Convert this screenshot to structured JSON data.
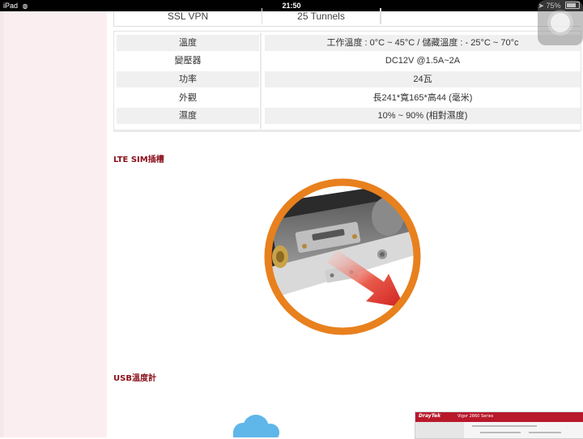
{
  "status_bar": {
    "device": "iPad",
    "time": "21:50",
    "battery": "75%"
  },
  "top_table": {
    "col1": "SSL VPN",
    "col2": "25 Tunnels"
  },
  "specs": [
    {
      "label": "溫度",
      "value": "工作溫度 : 0°C ~ 45°C / 儲藏溫度 : - 25°C ~ 70°c"
    },
    {
      "label": "變壓器",
      "value": "DC12V @1.5A~2A"
    },
    {
      "label": "功率",
      "value": "24瓦"
    },
    {
      "label": "外觀",
      "value": "長241*寬165*高44 (毫米)"
    },
    {
      "label": "濕度",
      "value": "10% ~ 90% (相對濕度)"
    }
  ],
  "sections": {
    "lte_sim": "LTE SIM插槽",
    "usb_temp": "USB溫度計"
  },
  "thumbnail": {
    "logo": "DrayTek",
    "model": "Vigor 2860 Series"
  },
  "colors": {
    "heading": "#8a0f1a",
    "sidebar": "#fbeef0",
    "ring": "#e8801e",
    "arrow": "#e0322c"
  }
}
